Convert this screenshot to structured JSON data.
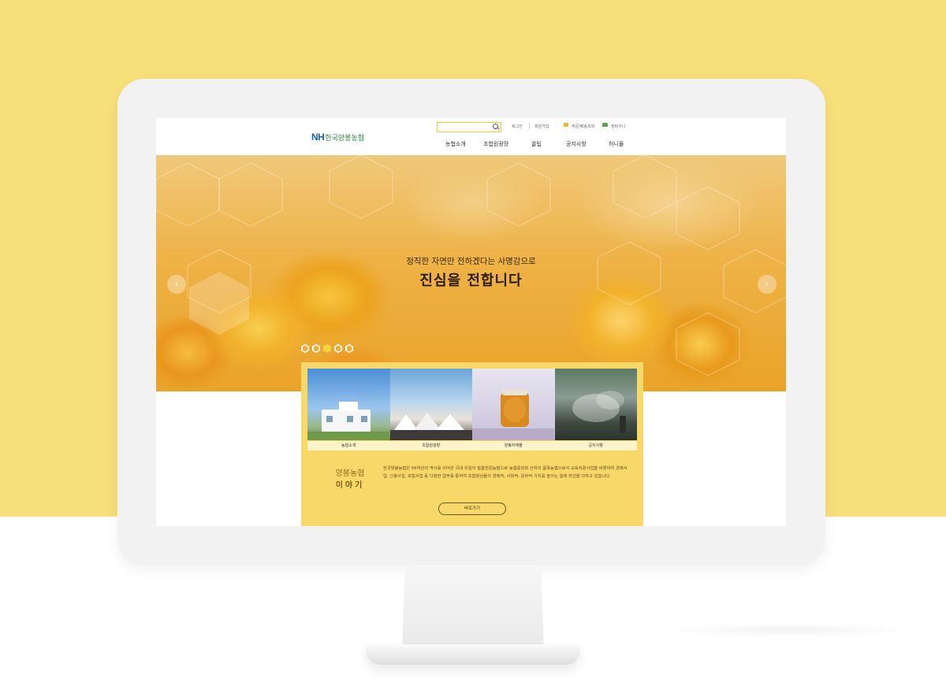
{
  "site": {
    "logo": {
      "mark": "NH",
      "name": "한국양봉농협"
    },
    "search": {
      "placeholder": ""
    },
    "utility": {
      "login": "로그인",
      "join": "회원가입",
      "order_lookup": "주문/배송조회",
      "cart": "장바구니"
    },
    "nav": [
      "농협소개",
      "조합원광장",
      "꿀팁",
      "공지사항",
      "허니몰"
    ],
    "hero": {
      "subtitle": "정직한 자연만 전하겠다는 사명감으로",
      "title": "진심을 전합니다",
      "slides_total": 5,
      "slide_active": 3
    },
    "cards": [
      {
        "label": "농협소개"
      },
      {
        "label": "조합원광장"
      },
      {
        "label": "양봉자재몰"
      },
      {
        "label": "공지사항"
      }
    ],
    "story": {
      "title_line1": "양봉농협",
      "title_line2": "이야기",
      "text": "한국양봉농협은 56여년의 역사를 이어온 국내 유일의 벌꿀전문농협으로 농협중앙회 산하의 품목농협으로서 교육지원사업을 비롯하여 경제사업, 신용사업, 보험사업 등 다양한 업무를 통하여 조합원님들의 경제적, 사회적, 문화적 가치를 높이는 일에 최선을 다하고 있습니다.",
      "button": "바로가기"
    },
    "colors": {
      "background_yellow": "#f7df7a",
      "panel_yellow": "#f9d86a",
      "logo_blue": "#1b5fae",
      "logo_green": "#2c8a3c",
      "search_border": "#f1c72c"
    }
  }
}
